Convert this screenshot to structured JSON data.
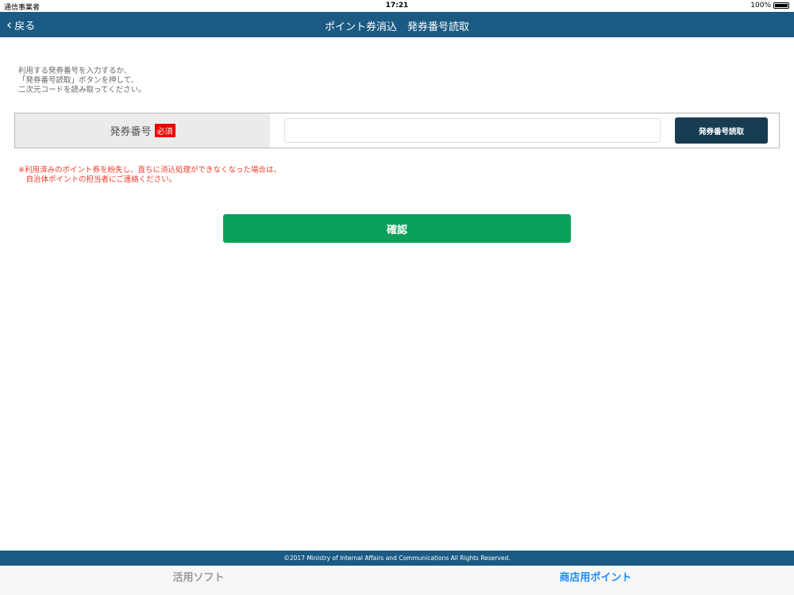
{
  "status": {
    "carrier": "通信事業者",
    "time": "17:21",
    "battery": "100%"
  },
  "nav": {
    "back": "戻る",
    "title": "ポイント券消込　発券番号読取"
  },
  "intro": [
    "利用する発券番号を入力するか、",
    "「発券番号読取」ボタンを押して、",
    "二次元コードを読み取ってください。"
  ],
  "form": {
    "label": "発券番号",
    "required": "必須",
    "value": "",
    "read_button": "発券番号読取"
  },
  "note": [
    "※利用済みのポイント券を紛失し、直ちに消込処理ができなくなった場合は、",
    "　自治体ポイントの担当者にご連絡ください。"
  ],
  "confirm": "確認",
  "footer": "©2017 Ministry of Internal Affairs and Communications All Rights Reserved.",
  "tabs": [
    {
      "label": "活用ソフト"
    },
    {
      "label": "商店用ポイント"
    }
  ]
}
